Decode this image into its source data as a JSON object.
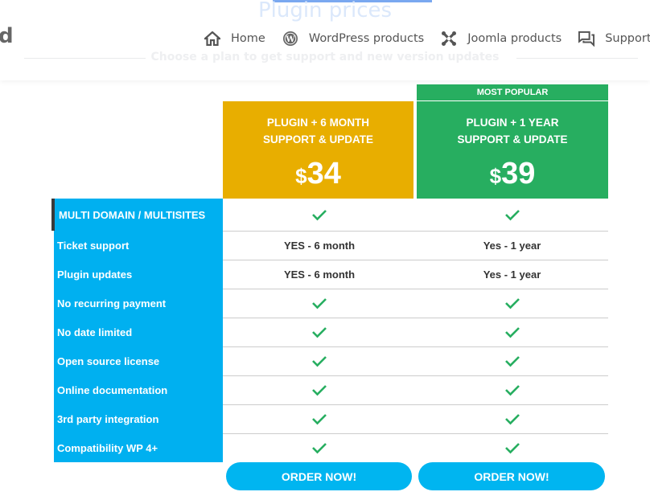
{
  "header": {
    "logo_fragment": "d",
    "page_title": "Plugin prices",
    "page_subtitle": "Choose a plan to get support and new version updates",
    "nav": [
      {
        "label": "Home",
        "icon": "home-icon"
      },
      {
        "label": "WordPress products",
        "icon": "wordpress-icon"
      },
      {
        "label": "Joomla products",
        "icon": "joomla-icon"
      },
      {
        "label": "Support",
        "icon": "chat-bubbles-icon"
      }
    ]
  },
  "pricing": {
    "popular_badge": "MOST POPULAR",
    "plans": [
      {
        "name_line1": "PLUGIN + 6 MONTH",
        "name_line2": "SUPPORT & UPDATE",
        "currency": "$",
        "price": "34",
        "color": "#e8ae00",
        "order_label": "ORDER NOW!"
      },
      {
        "name_line1": "PLUGIN + 1 YEAR",
        "name_line2": "SUPPORT & UPDATE",
        "currency": "$",
        "price": "39",
        "color": "#27ae60",
        "order_label": "ORDER NOW!"
      }
    ],
    "features": [
      {
        "label": "MULTI DOMAIN / MULTISITES",
        "plan1": "check",
        "plan2": "check"
      },
      {
        "label": "Ticket support",
        "plan1": "YES - 6 month",
        "plan2": "Yes - 1 year"
      },
      {
        "label": "Plugin updates",
        "plan1": "YES - 6 month",
        "plan2": "Yes - 1 year"
      },
      {
        "label": "No recurring payment",
        "plan1": "check",
        "plan2": "check"
      },
      {
        "label": "No date limited",
        "plan1": "check",
        "plan2": "check"
      },
      {
        "label": "Open source license",
        "plan1": "check",
        "plan2": "check"
      },
      {
        "label": "Online documentation",
        "plan1": "check",
        "plan2": "check"
      },
      {
        "label": "3rd party integration",
        "plan1": "check",
        "plan2": "check"
      },
      {
        "label": "Compatibility WP 4+",
        "plan1": "check",
        "plan2": "check"
      }
    ],
    "colors": {
      "feature_column": "#00b0f0",
      "check": "#27ae60",
      "order_button": "#00b5f0"
    }
  }
}
